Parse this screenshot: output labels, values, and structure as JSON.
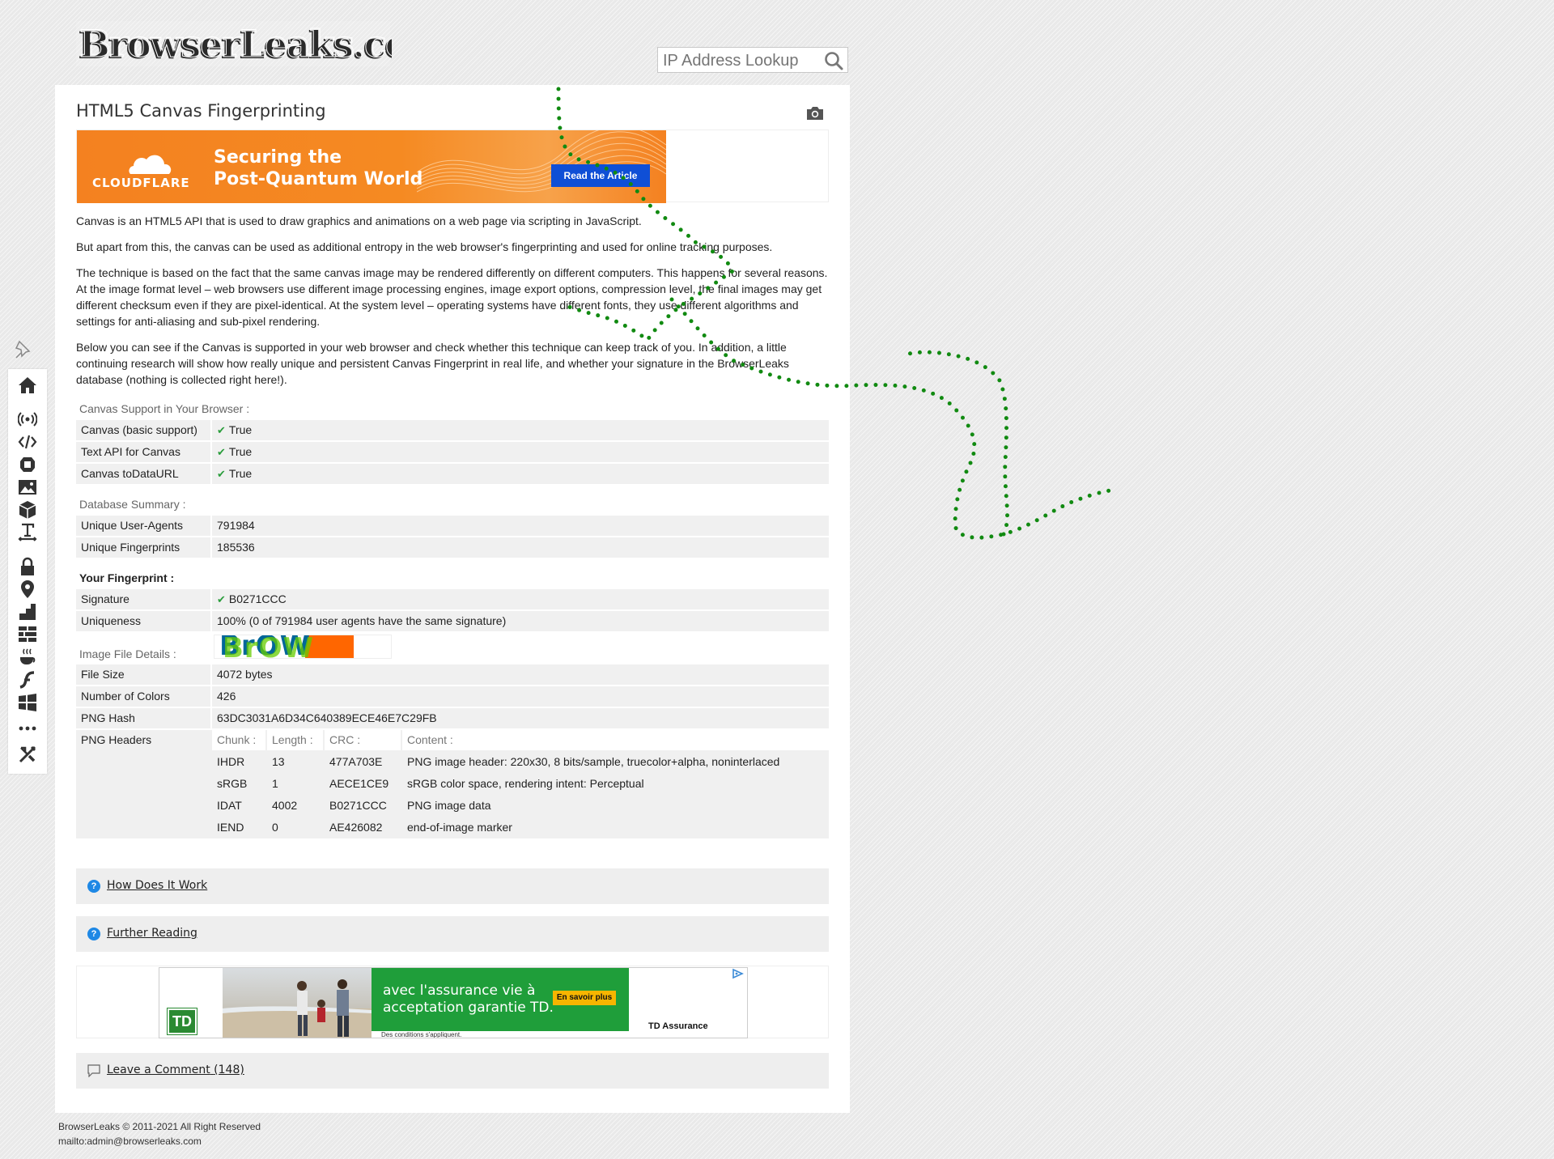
{
  "brand": {
    "logo_text": "BrowserLeaks.com"
  },
  "search": {
    "placeholder": "IP Address Lookup"
  },
  "sidebar": {
    "items": [
      "home-icon",
      "wifi-icon",
      "code-icon",
      "webgl-icon",
      "image-icon",
      "cube-icon",
      "font-icon",
      "lock-icon",
      "location-icon",
      "chart-icon",
      "bricks-icon",
      "java-icon",
      "flash-icon",
      "windows-icon",
      "more-icon",
      "tools-icon"
    ]
  },
  "page": {
    "title": "HTML5 Canvas Fingerprinting"
  },
  "ad_top": {
    "brand": "CLOUDFLARE",
    "headline_line1": "Securing the",
    "headline_line2": "Post-Quantum World",
    "cta": "Read the Article"
  },
  "intro": {
    "p1": "Canvas is an HTML5 API that is used to draw graphics and animations on a web page via scripting in JavaScript.",
    "p2": "But apart from this, the canvas can be used as additional entropy in the web browser's fingerprinting and used for online tracking purposes.",
    "p3": "The technique is based on the fact that the same canvas image may be rendered differently on different computers. This happens for several reasons. At the image format level – web browsers use different image processing engines, image export options, compression level, the final images may get different checksum even if they are pixel-identical. At the system level – operating systems have different fonts, they use different algorithms and settings for anti-aliasing and sub-pixel rendering.",
    "p4": "Below you can see if the Canvas is supported in your web browser and check whether this technique can keep track of you. In addition, a little continuing research will show how really unique and persistent Canvas Fingerprint in real life, and whether your signature in the BrowserLeaks database (nothing is collected right here!)."
  },
  "support": {
    "label": "Canvas Support in Your Browser :",
    "rows": [
      {
        "key": "Canvas (basic support)",
        "value": "True"
      },
      {
        "key": "Text API for Canvas",
        "value": "True"
      },
      {
        "key": "Canvas toDataURL",
        "value": "True"
      }
    ]
  },
  "database": {
    "label": "Database Summary :",
    "rows": [
      {
        "key": "Unique User-Agents",
        "value": "791984"
      },
      {
        "key": "Unique Fingerprints",
        "value": "185536"
      }
    ]
  },
  "fingerprint": {
    "label": "Your Fingerprint :",
    "signature_key": "Signature",
    "signature_value": "B0271CCC",
    "uniqueness_key": "Uniqueness",
    "uniqueness_value": "100% (0 of 791984 user agents have the same signature)"
  },
  "image_details": {
    "label": "Image File Details :",
    "rows": [
      {
        "key": "File Size",
        "value": "4072 bytes"
      },
      {
        "key": "Number of Colors",
        "value": "426"
      },
      {
        "key": "PNG Hash",
        "value": "63DC3031A6D34C640389ECE46E7C29FB"
      }
    ],
    "png_headers_key": "PNG Headers",
    "png_columns": [
      "Chunk :",
      "Length :",
      "CRC :",
      "Content :"
    ],
    "png_rows": [
      [
        "IHDR",
        "13",
        "477A703E",
        "PNG image header: 220x30, 8 bits/sample, truecolor+alpha, noninterlaced"
      ],
      [
        "sRGB",
        "1",
        "AECE1CE9",
        "sRGB color space, rendering intent: Perceptual"
      ],
      [
        "IDAT",
        "4002",
        "B0271CCC",
        "PNG image data"
      ],
      [
        "IEND",
        "0",
        "AE426082",
        "end-of-image marker"
      ]
    ]
  },
  "accordions": {
    "how": "How Does It Work",
    "further": "Further Reading",
    "comment": "Leave a Comment",
    "comment_count": "(148)"
  },
  "ad_bottom": {
    "logo": "TD",
    "text_line1": "avec l'assurance vie à",
    "text_line2": "acceptation garantie TD.",
    "cta": "En savoir plus",
    "disclaimer": "Des conditions s'appliquent.",
    "brand": "TD Assurance"
  },
  "footer": {
    "copyright": "BrowserLeaks © 2011-2021 All Right Reserved",
    "email": "mailto:admin@browserleaks.com"
  },
  "colors": {
    "accent_orange": "#f48120",
    "check_green": "#2a9d3c",
    "trail_green": "#1a8a1a",
    "td_green": "#1f9e3a"
  }
}
